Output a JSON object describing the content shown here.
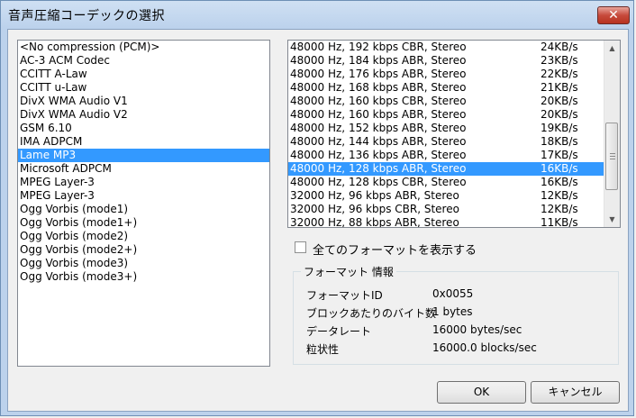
{
  "window": {
    "title": "音声圧縮コーデックの選択",
    "close_label": "✕"
  },
  "codecs": {
    "items": [
      "<No compression (PCM)>",
      "AC-3 ACM Codec",
      "CCITT A-Law",
      "CCITT u-Law",
      "DivX WMA Audio V1",
      "DivX WMA Audio V2",
      "GSM 6.10",
      "IMA ADPCM",
      "Lame MP3",
      "Microsoft ADPCM",
      "MPEG Layer-3",
      "MPEG Layer-3",
      "Ogg Vorbis (mode1)",
      "Ogg Vorbis (mode1+)",
      "Ogg Vorbis (mode2)",
      "Ogg Vorbis (mode2+)",
      "Ogg Vorbis (mode3)",
      "Ogg Vorbis (mode3+)"
    ],
    "selected": "Lame MP3"
  },
  "formats": {
    "rows": [
      {
        "desc": "48000 Hz, 192 kbps CBR, Stereo",
        "rate": "24KB/s"
      },
      {
        "desc": "48000 Hz, 184 kbps ABR, Stereo",
        "rate": "23KB/s"
      },
      {
        "desc": "48000 Hz, 176 kbps ABR, Stereo",
        "rate": "22KB/s"
      },
      {
        "desc": "48000 Hz, 168 kbps ABR, Stereo",
        "rate": "21KB/s"
      },
      {
        "desc": "48000 Hz, 160 kbps CBR, Stereo",
        "rate": "20KB/s"
      },
      {
        "desc": "48000 Hz, 160 kbps ABR, Stereo",
        "rate": "20KB/s"
      },
      {
        "desc": "48000 Hz, 152 kbps ABR, Stereo",
        "rate": "19KB/s"
      },
      {
        "desc": "48000 Hz, 144 kbps ABR, Stereo",
        "rate": "18KB/s"
      },
      {
        "desc": "48000 Hz, 136 kbps ABR, Stereo",
        "rate": "17KB/s"
      },
      {
        "desc": "48000 Hz, 128 kbps ABR, Stereo",
        "rate": "16KB/s"
      },
      {
        "desc": "48000 Hz, 128 kbps CBR, Stereo",
        "rate": "16KB/s"
      },
      {
        "desc": "32000 Hz, 96 kbps ABR, Stereo",
        "rate": "12KB/s"
      },
      {
        "desc": "32000 Hz, 96 kbps CBR, Stereo",
        "rate": "12KB/s"
      },
      {
        "desc": "32000 Hz, 88 kbps ABR, Stereo",
        "rate": "11KB/s"
      }
    ],
    "selected_index": 9
  },
  "show_all": {
    "label": "全てのフォーマットを表示する",
    "checked": false
  },
  "format_info": {
    "title": "フォーマット 情報",
    "fields": [
      {
        "label": "フォーマットID",
        "value": "0x0055"
      },
      {
        "label": "ブロックあたりのバイト数",
        "value": "1 bytes"
      },
      {
        "label": "データレート",
        "value": "16000 bytes/sec"
      },
      {
        "label": "粒状性",
        "value": "16000.0 blocks/sec"
      }
    ]
  },
  "buttons": {
    "ok": "OK",
    "cancel": "キャンセル"
  }
}
